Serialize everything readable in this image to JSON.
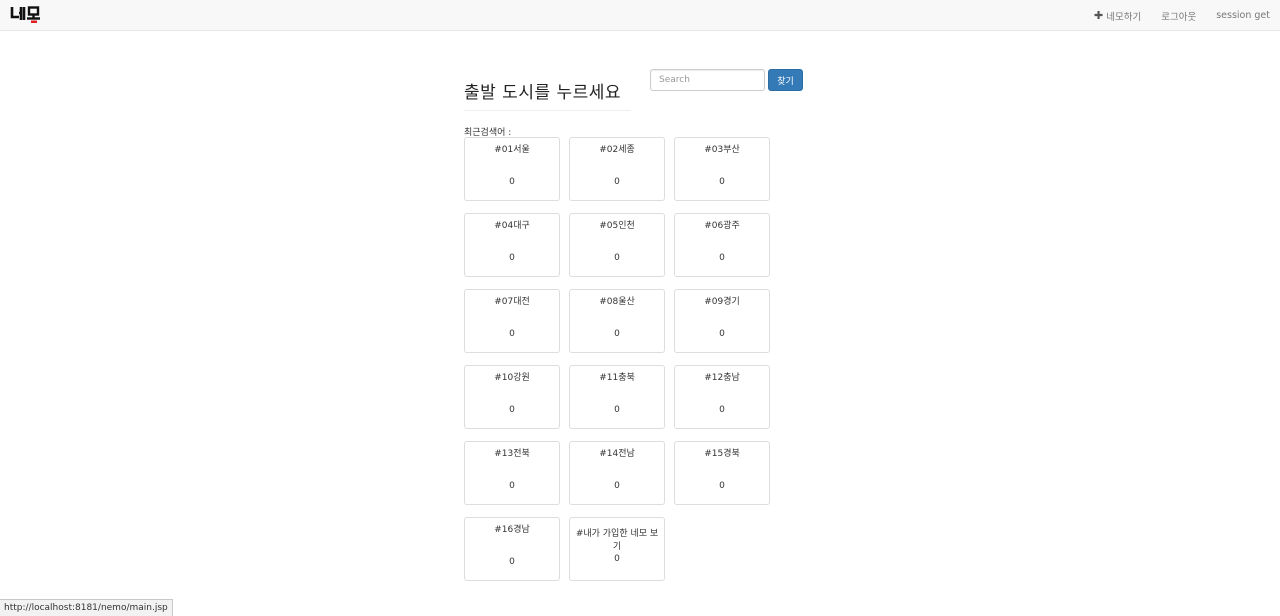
{
  "navbar": {
    "brand": "네모",
    "links": [
      {
        "icon": "plus-icon",
        "label": "네모하기"
      },
      {
        "label": "로그아웃"
      },
      {
        "label": "session get"
      }
    ]
  },
  "main": {
    "title": "출발 도시를 누르세요",
    "search": {
      "placeholder": "Search",
      "button_label": "찾기"
    },
    "recent_label": "최근검색어 :",
    "cities": [
      {
        "name": "#01서울",
        "count": "0"
      },
      {
        "name": "#02세종",
        "count": "0"
      },
      {
        "name": "#03부산",
        "count": "0"
      },
      {
        "name": "#04대구",
        "count": "0"
      },
      {
        "name": "#05인천",
        "count": "0"
      },
      {
        "name": "#06광주",
        "count": "0"
      },
      {
        "name": "#07대전",
        "count": "0"
      },
      {
        "name": "#08울산",
        "count": "0"
      },
      {
        "name": "#09경기",
        "count": "0"
      },
      {
        "name": "#10강원",
        "count": "0"
      },
      {
        "name": "#11충북",
        "count": "0"
      },
      {
        "name": "#12충남",
        "count": "0"
      },
      {
        "name": "#13전북",
        "count": "0"
      },
      {
        "name": "#14전남",
        "count": "0"
      },
      {
        "name": "#15경북",
        "count": "0"
      },
      {
        "name": "#16경남",
        "count": "0"
      },
      {
        "name": "#내가 가입한 네모 보기",
        "count": "0"
      }
    ]
  },
  "status_bar": {
    "url": "http://localhost:8181/nemo/main.jsp"
  },
  "colors": {
    "primary_button": "#337ab7",
    "navbar_bg": "#f8f8f8",
    "brand_accent": "#e02020"
  }
}
